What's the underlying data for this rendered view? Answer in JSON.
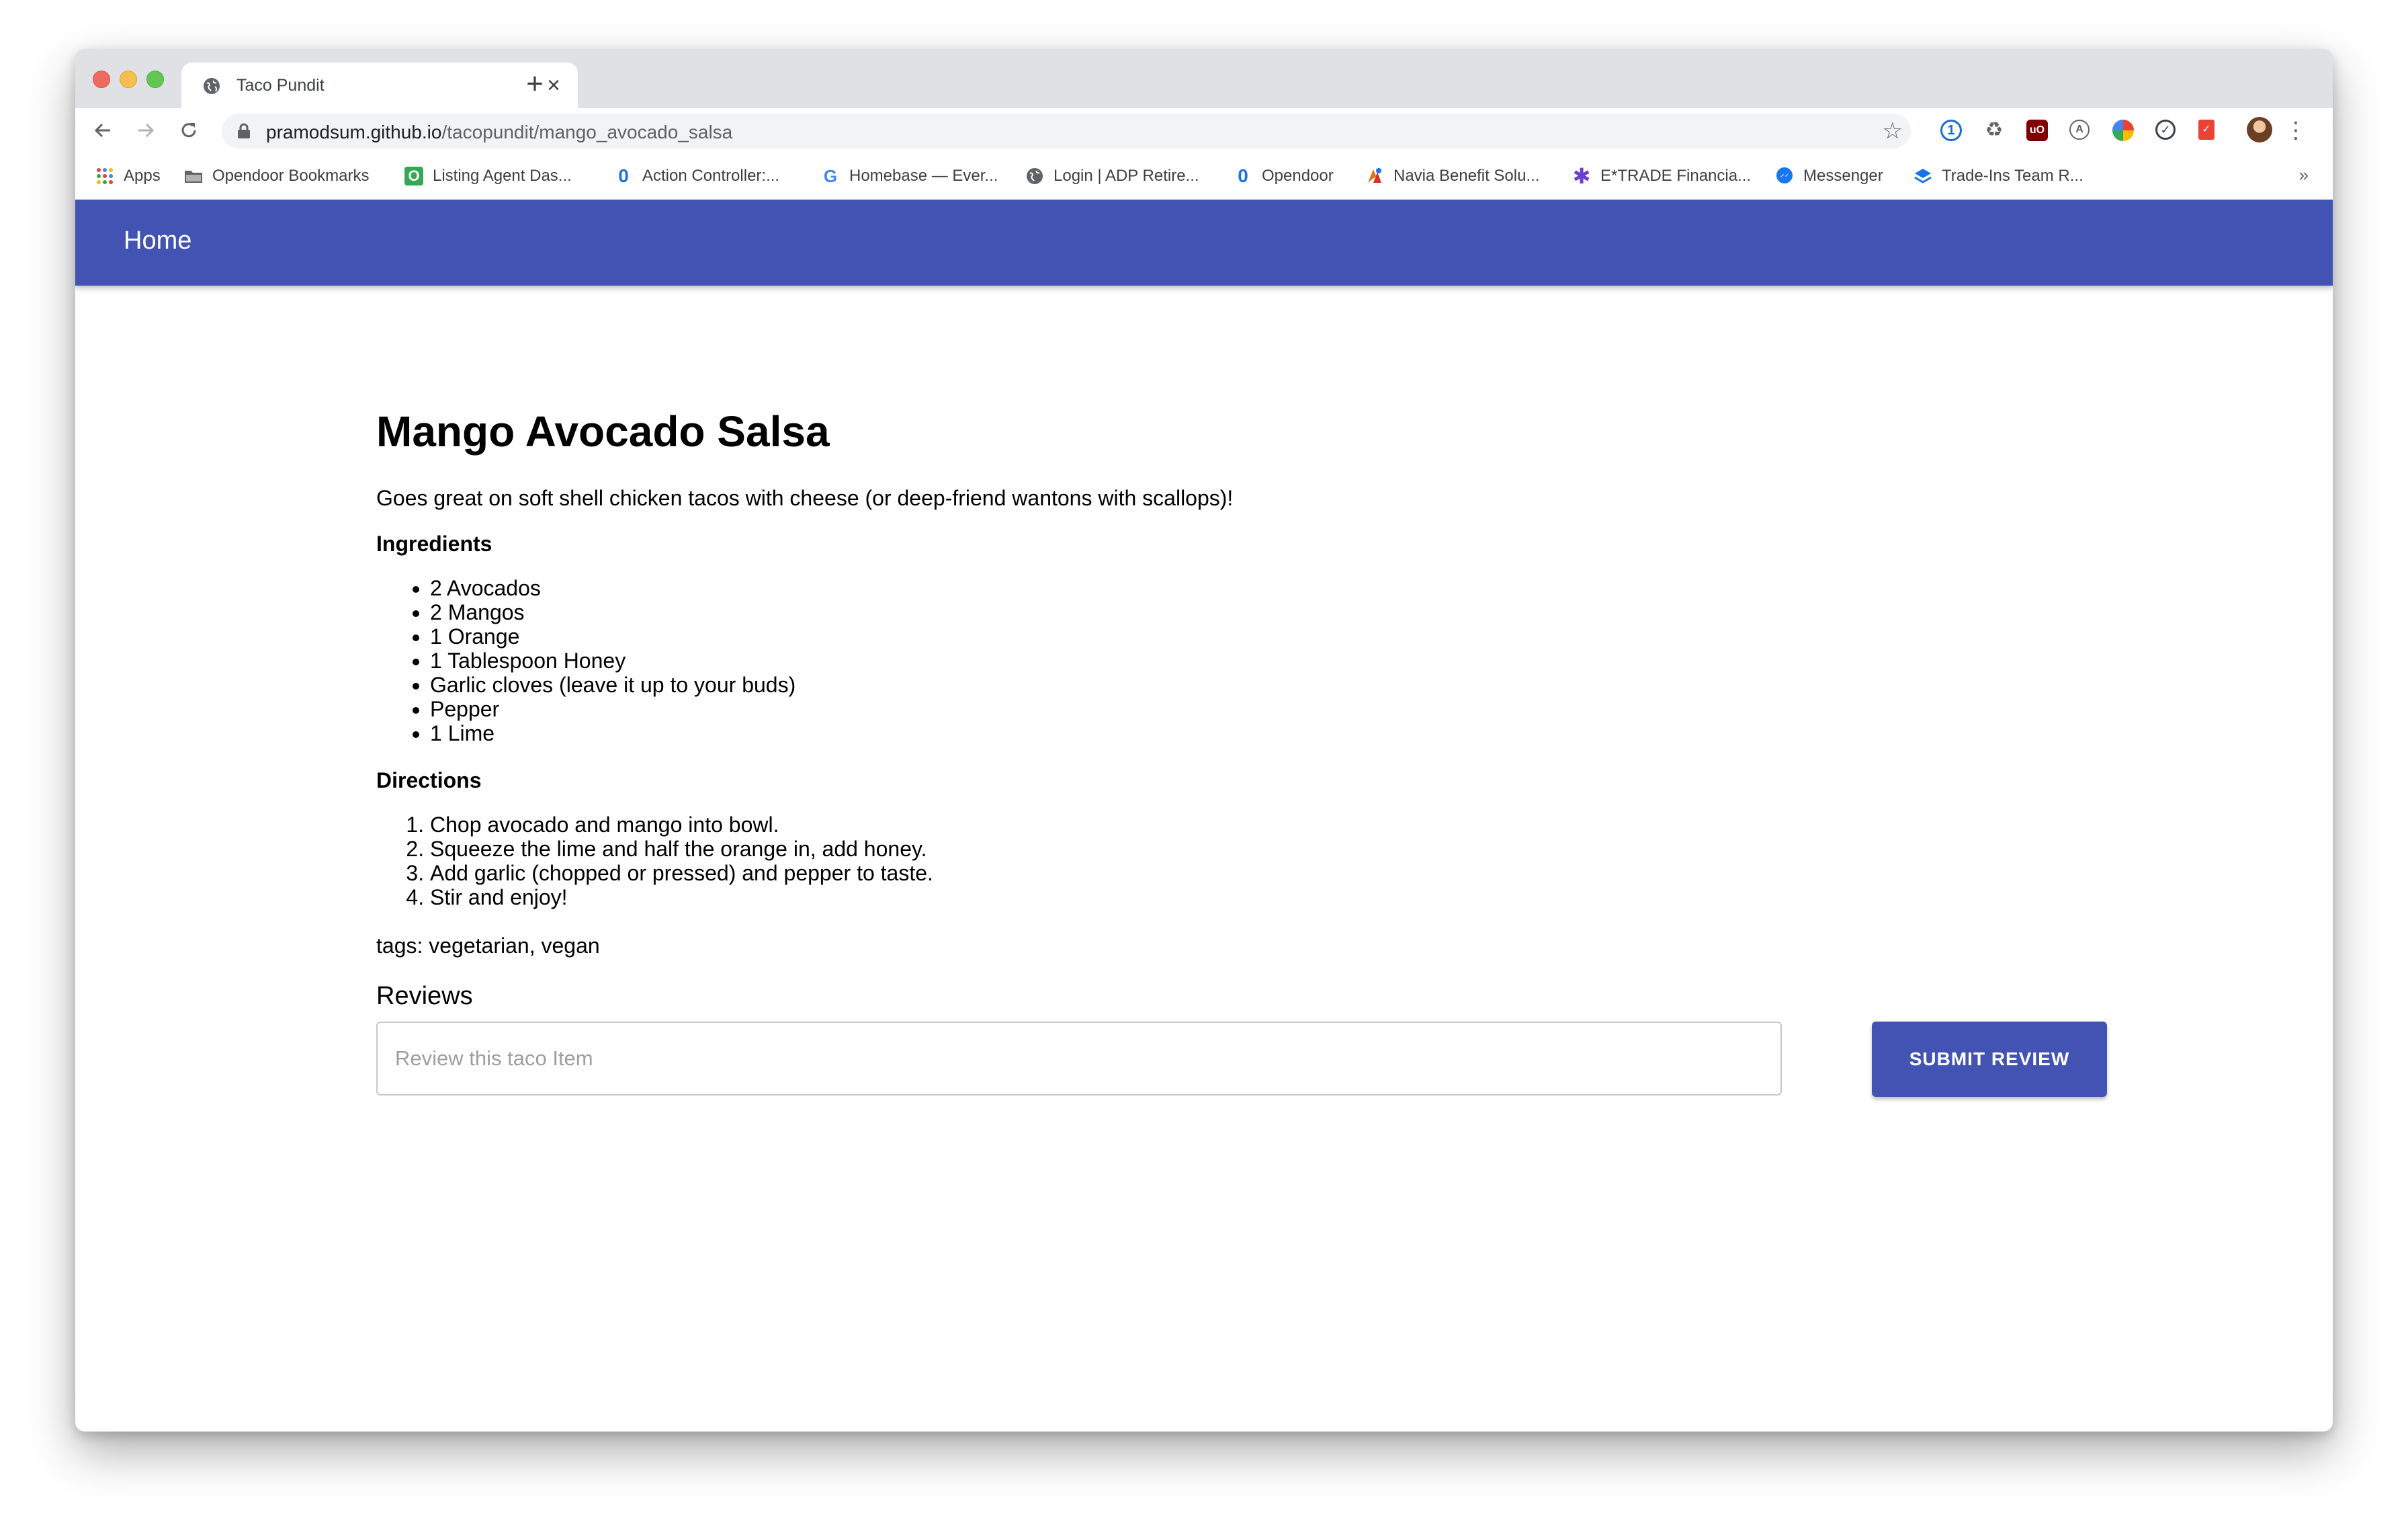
{
  "browser": {
    "tab_title": "Taco Pundit",
    "tab_close": "×",
    "new_tab": "+",
    "url_host": "pramodsum.github.io",
    "url_path": "/tacopundit/mango_avocado_salsa",
    "bookmarks": [
      {
        "label": "Apps",
        "icon": "apps-grid-icon"
      },
      {
        "label": "Opendoor Bookmarks",
        "icon": "folder-icon"
      },
      {
        "label": "Listing Agent Das...",
        "icon": "opendoor-green-icon"
      },
      {
        "label": "Action Controller:...",
        "icon": "opendoor-blue-icon"
      },
      {
        "label": "Homebase — Ever...",
        "icon": "google-icon"
      },
      {
        "label": "Login | ADP Retire...",
        "icon": "globe-icon"
      },
      {
        "label": "Opendoor",
        "icon": "opendoor-blue-icon"
      },
      {
        "label": "Navia Benefit Solu...",
        "icon": "navia-icon"
      },
      {
        "label": "E*TRADE Financia...",
        "icon": "etrade-icon"
      },
      {
        "label": "Messenger",
        "icon": "messenger-icon"
      },
      {
        "label": "Trade-Ins Team R...",
        "icon": "stack-icon"
      }
    ],
    "bookmarks_overflow": "»"
  },
  "appbar": {
    "home_label": "Home",
    "color": "#4353b3"
  },
  "recipe": {
    "title": "Mango Avocado Salsa",
    "description": "Goes great on soft shell chicken tacos with cheese (or deep-friend wantons with scallops)!",
    "ingredients_heading": "Ingredients",
    "ingredients": [
      "2 Avocados",
      "2 Mangos",
      "1 Orange",
      "1 Tablespoon Honey",
      "Garlic cloves (leave it up to your buds)",
      "Pepper",
      "1 Lime"
    ],
    "directions_heading": "Directions",
    "directions": [
      "Chop avocado and mango into bowl.",
      "Squeeze the lime and half the orange in, add honey.",
      "Add garlic (chopped or pressed) and pepper to taste.",
      "Stir and enjoy!"
    ],
    "tags": "tags: vegetarian, vegan"
  },
  "reviews": {
    "heading": "Reviews",
    "input_placeholder": "Review this taco Item",
    "input_value": "",
    "submit_label": "SUBMIT REVIEW"
  }
}
